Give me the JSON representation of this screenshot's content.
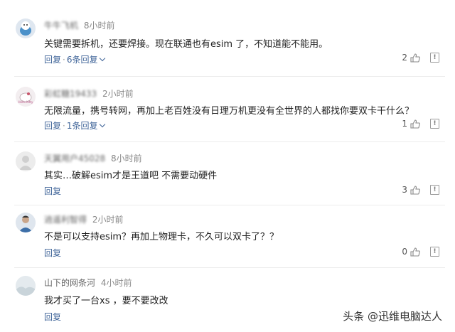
{
  "comments": [
    {
      "name": "牛牛飞机",
      "time": "8小时前",
      "text": "关键需要拆机，还要焊接。现在联通也有esim 了，不知道能不能用。",
      "reply_label": "回复",
      "replies_label": "6条回复",
      "likes": "2",
      "avatar_icon": "cartoon-avatar-icon"
    },
    {
      "name": "彩虹糖19433",
      "time": "2小时前",
      "text": "无限流量，携号转网，再加上老百姓没有日理万机更没有全世界的人都找你要双卡干什么？",
      "reply_label": "回复",
      "replies_label": "1条回复",
      "likes": "1",
      "avatar_icon": "hello-kitty-avatar-icon"
    },
    {
      "name": "天翼用户45028",
      "time": "8小时前",
      "text": "其实…破解esim才是王道吧 不需要动硬件",
      "reply_label": "回复",
      "replies_label": "",
      "likes": "3",
      "avatar_icon": "default-avatar-icon"
    },
    {
      "name": "逍遥利智得",
      "time": "2小时前",
      "text": "不是可以支持esim？再加上物理卡，不久可以双卡了？？",
      "reply_label": "回复",
      "replies_label": "",
      "likes": "0",
      "avatar_icon": "person-photo-avatar-icon"
    },
    {
      "name": "山下的网条河",
      "time": "4小时前",
      "text": "我才买了一台xs ，要不要改改",
      "reply_label": "回复",
      "replies_label": "",
      "likes": "",
      "avatar_icon": "landscape-avatar-icon"
    }
  ],
  "separator": "·",
  "report_icon": "!",
  "watermark": "头条 @迅维电脑达人",
  "colors": {
    "link": "#406599",
    "meta": "#888888",
    "divider": "#ececec"
  }
}
